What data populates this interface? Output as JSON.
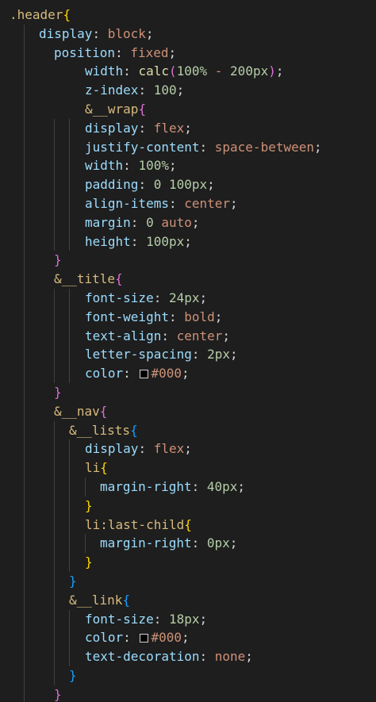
{
  "lines": [
    [
      {
        "t": ".header",
        "c": "sel"
      },
      {
        "t": "{",
        "c": "br1"
      }
    ],
    [
      {
        "t": "display",
        "c": "prop"
      },
      {
        "t": ": ",
        "c": "punc"
      },
      {
        "t": "block",
        "c": "val"
      },
      {
        "t": ";",
        "c": "punc"
      }
    ],
    [
      {
        "t": "position",
        "c": "prop"
      },
      {
        "t": ": ",
        "c": "punc"
      },
      {
        "t": "fixed",
        "c": "val"
      },
      {
        "t": ";",
        "c": "punc"
      }
    ],
    [
      {
        "t": "width",
        "c": "prop"
      },
      {
        "t": ": ",
        "c": "punc"
      },
      {
        "t": "calc",
        "c": "fn"
      },
      {
        "t": "(",
        "c": "br2"
      },
      {
        "t": "100%",
        "c": "num"
      },
      {
        "t": " - ",
        "c": "val"
      },
      {
        "t": "200px",
        "c": "num"
      },
      {
        "t": ")",
        "c": "br2"
      },
      {
        "t": ";",
        "c": "punc"
      }
    ],
    [
      {
        "t": "z-index",
        "c": "prop"
      },
      {
        "t": ": ",
        "c": "punc"
      },
      {
        "t": "100",
        "c": "num"
      },
      {
        "t": ";",
        "c": "punc"
      }
    ],
    [
      {
        "t": "&__wrap",
        "c": "sel"
      },
      {
        "t": "{",
        "c": "br2"
      }
    ],
    [
      {
        "t": "display",
        "c": "prop"
      },
      {
        "t": ": ",
        "c": "punc"
      },
      {
        "t": "flex",
        "c": "val"
      },
      {
        "t": ";",
        "c": "punc"
      }
    ],
    [
      {
        "t": "justify-content",
        "c": "prop"
      },
      {
        "t": ": ",
        "c": "punc"
      },
      {
        "t": "space-between",
        "c": "val"
      },
      {
        "t": ";",
        "c": "punc"
      }
    ],
    [
      {
        "t": "width",
        "c": "prop"
      },
      {
        "t": ": ",
        "c": "punc"
      },
      {
        "t": "100%",
        "c": "num"
      },
      {
        "t": ";",
        "c": "punc"
      }
    ],
    [
      {
        "t": "padding",
        "c": "prop"
      },
      {
        "t": ": ",
        "c": "punc"
      },
      {
        "t": "0",
        "c": "num"
      },
      {
        "t": " ",
        "c": "punc"
      },
      {
        "t": "100px",
        "c": "num"
      },
      {
        "t": ";",
        "c": "punc"
      }
    ],
    [
      {
        "t": "align-items",
        "c": "prop"
      },
      {
        "t": ": ",
        "c": "punc"
      },
      {
        "t": "center",
        "c": "val"
      },
      {
        "t": ";",
        "c": "punc"
      }
    ],
    [
      {
        "t": "margin",
        "c": "prop"
      },
      {
        "t": ": ",
        "c": "punc"
      },
      {
        "t": "0",
        "c": "num"
      },
      {
        "t": " auto",
        "c": "val"
      },
      {
        "t": ";",
        "c": "punc"
      }
    ],
    [
      {
        "t": "height",
        "c": "prop"
      },
      {
        "t": ": ",
        "c": "punc"
      },
      {
        "t": "100px",
        "c": "num"
      },
      {
        "t": ";",
        "c": "punc"
      }
    ],
    [
      {
        "t": "}",
        "c": "br2"
      }
    ],
    [
      {
        "t": "&__title",
        "c": "sel"
      },
      {
        "t": "{",
        "c": "br2"
      }
    ],
    [
      {
        "t": "font-size",
        "c": "prop"
      },
      {
        "t": ": ",
        "c": "punc"
      },
      {
        "t": "24px",
        "c": "num"
      },
      {
        "t": ";",
        "c": "punc"
      }
    ],
    [
      {
        "t": "font-weight",
        "c": "prop"
      },
      {
        "t": ": ",
        "c": "punc"
      },
      {
        "t": "bold",
        "c": "val"
      },
      {
        "t": ";",
        "c": "punc"
      }
    ],
    [
      {
        "t": "text-align",
        "c": "prop"
      },
      {
        "t": ": ",
        "c": "punc"
      },
      {
        "t": "center",
        "c": "val"
      },
      {
        "t": ";",
        "c": "punc"
      }
    ],
    [
      {
        "t": "letter-spacing",
        "c": "prop"
      },
      {
        "t": ": ",
        "c": "punc"
      },
      {
        "t": "2px",
        "c": "num"
      },
      {
        "t": ";",
        "c": "punc"
      }
    ],
    [
      {
        "t": "color",
        "c": "prop"
      },
      {
        "t": ": ",
        "c": "punc"
      },
      {
        "t": "",
        "c": "swatch"
      },
      {
        "t": "#000",
        "c": "val"
      },
      {
        "t": ";",
        "c": "punc"
      }
    ],
    [
      {
        "t": "}",
        "c": "br2"
      }
    ],
    [
      {
        "t": "&__nav",
        "c": "sel"
      },
      {
        "t": "{",
        "c": "br2"
      }
    ],
    [
      {
        "t": "&__lists",
        "c": "sel"
      },
      {
        "t": "{",
        "c": "br3"
      }
    ],
    [
      {
        "t": "display",
        "c": "prop"
      },
      {
        "t": ": ",
        "c": "punc"
      },
      {
        "t": "flex",
        "c": "val"
      },
      {
        "t": ";",
        "c": "punc"
      }
    ],
    [
      {
        "t": "li",
        "c": "sel"
      },
      {
        "t": "{",
        "c": "br1"
      }
    ],
    [
      {
        "t": "margin-right",
        "c": "prop"
      },
      {
        "t": ": ",
        "c": "punc"
      },
      {
        "t": "40px",
        "c": "num"
      },
      {
        "t": ";",
        "c": "punc"
      }
    ],
    [
      {
        "t": "}",
        "c": "br1"
      }
    ],
    [
      {
        "t": "li:last-child",
        "c": "sel"
      },
      {
        "t": "{",
        "c": "br1"
      }
    ],
    [
      {
        "t": "margin-right",
        "c": "prop"
      },
      {
        "t": ": ",
        "c": "punc"
      },
      {
        "t": "0px",
        "c": "num"
      },
      {
        "t": ";",
        "c": "punc"
      }
    ],
    [
      {
        "t": "}",
        "c": "br1"
      }
    ],
    [
      {
        "t": "}",
        "c": "br3"
      }
    ],
    [
      {
        "t": "&__link",
        "c": "sel"
      },
      {
        "t": "{",
        "c": "br3"
      }
    ],
    [
      {
        "t": "font-size",
        "c": "prop"
      },
      {
        "t": ": ",
        "c": "punc"
      },
      {
        "t": "18px",
        "c": "num"
      },
      {
        "t": ";",
        "c": "punc"
      }
    ],
    [
      {
        "t": "color",
        "c": "prop"
      },
      {
        "t": ": ",
        "c": "punc"
      },
      {
        "t": "",
        "c": "swatch"
      },
      {
        "t": "#000",
        "c": "val"
      },
      {
        "t": ";",
        "c": "punc"
      }
    ],
    [
      {
        "t": "text-decoration",
        "c": "prop"
      },
      {
        "t": ": ",
        "c": "punc"
      },
      {
        "t": "none",
        "c": "val"
      },
      {
        "t": ";",
        "c": "punc"
      }
    ],
    [
      {
        "t": "}",
        "c": "br3"
      }
    ],
    [
      {
        "t": "}",
        "c": "br2"
      }
    ]
  ],
  "colors": {
    "background": "#1e1e1e",
    "selector": "#d7ba7d",
    "property": "#9cdcfe",
    "value": "#ce9178",
    "number": "#b5cea8",
    "function": "#dcdcaa",
    "bracket_gold": "#ffd700",
    "bracket_purple": "#da70d6",
    "bracket_blue": "#179fff"
  }
}
